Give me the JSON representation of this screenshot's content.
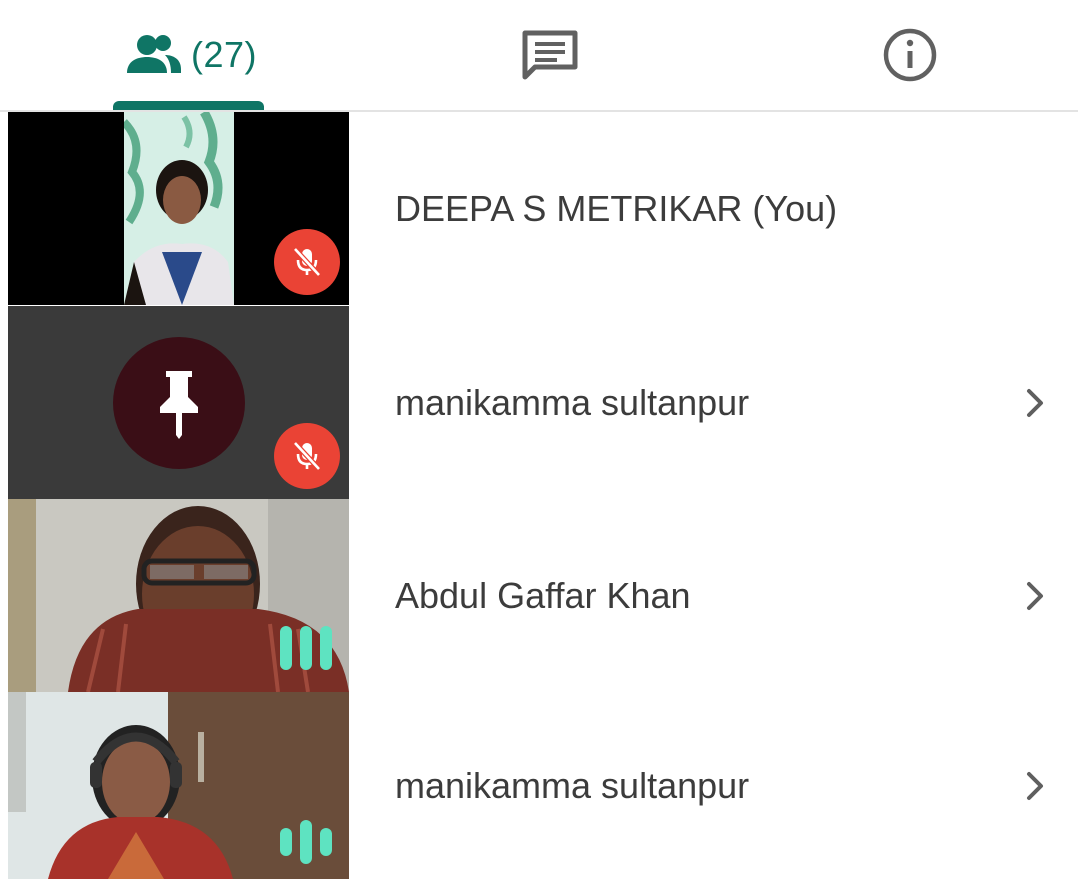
{
  "tabs": {
    "people": {
      "icon": "people-icon",
      "count": "(27)"
    },
    "chat": {
      "icon": "chat-icon"
    },
    "info": {
      "icon": "info-icon"
    }
  },
  "colors": {
    "accent": "#0f7565",
    "mute_badge": "#ea4335",
    "talking_indicator": "#5ee3c1",
    "avatar_bg": "#3a0e16",
    "name_text": "#3c3c3c"
  },
  "participants": [
    {
      "name": "DEEPA S METRIKAR (You)",
      "status": "muted",
      "video": "camera-on",
      "has_chevron": false
    },
    {
      "name": "manikamma sultanpur",
      "status": "muted",
      "video": "camera-off",
      "avatar_icon": "pin-icon",
      "has_chevron": true
    },
    {
      "name": "Abdul Gaffar Khan",
      "status": "speaking",
      "video": "camera-on",
      "has_chevron": true
    },
    {
      "name": "manikamma sultanpur",
      "status": "speaking",
      "video": "camera-on",
      "has_chevron": true
    }
  ]
}
